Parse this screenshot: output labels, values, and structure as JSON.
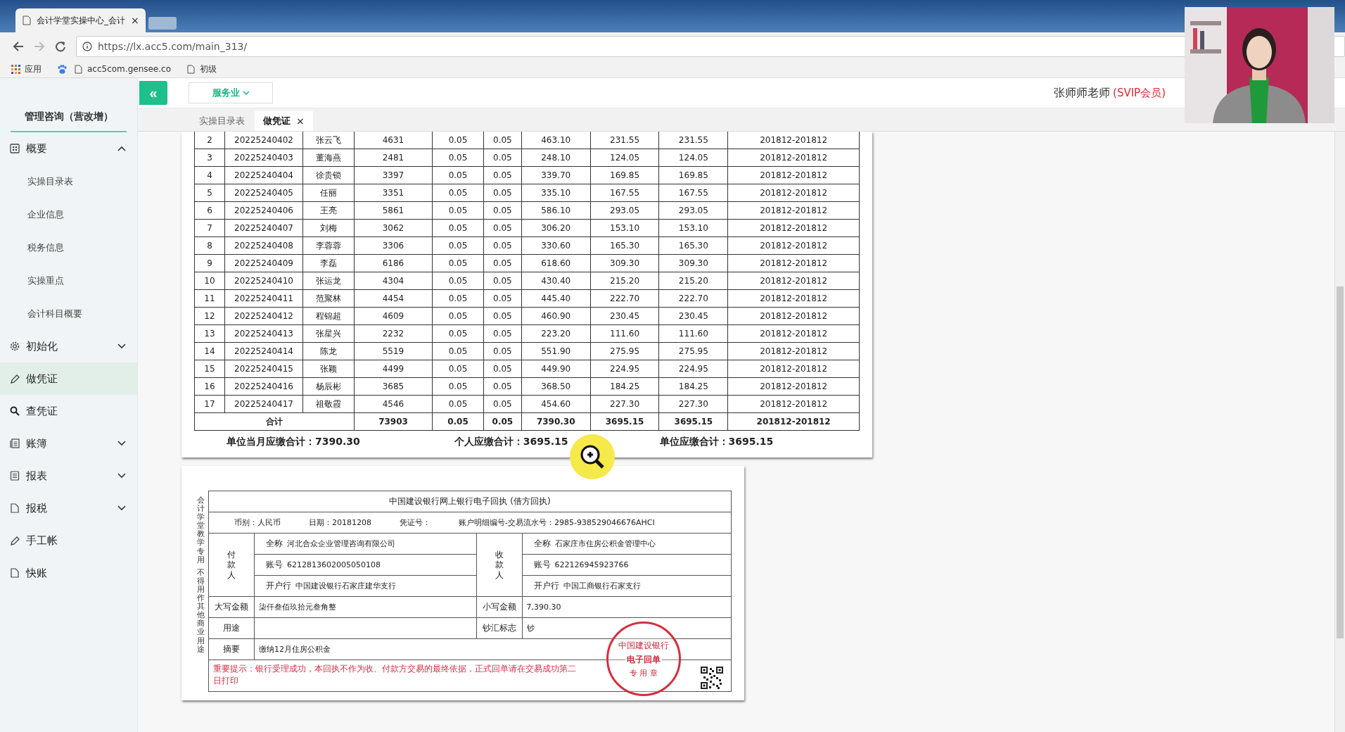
{
  "browser": {
    "tab_title": "会计学堂实操中心_会计",
    "tab_close": "×",
    "url": "https://lx.acc5.com/main_313/",
    "bookmarks": [
      "应用",
      "acc5com.gensee.co",
      "初级"
    ]
  },
  "sidebar": {
    "company": "管理咨询（营改增）",
    "items": [
      {
        "label": "概要",
        "selected": false,
        "expanded": true,
        "children": [
          {
            "label": "实操目录表",
            "selected": false
          },
          {
            "label": "企业信息",
            "selected": false
          },
          {
            "label": "税务信息",
            "selected": false
          },
          {
            "label": "实操重点",
            "selected": false
          },
          {
            "label": "会计科目概要",
            "selected": false
          }
        ]
      },
      {
        "label": "初始化",
        "selected": false,
        "expanded": false
      },
      {
        "label": "做凭证",
        "selected": true
      },
      {
        "label": "查凭证",
        "selected": false
      },
      {
        "label": "账簿",
        "selected": false,
        "expanded": false
      },
      {
        "label": "报表",
        "selected": false,
        "expanded": false
      },
      {
        "label": "报税",
        "selected": false,
        "expanded": false
      },
      {
        "label": "手工帐",
        "selected": false
      },
      {
        "label": "快账",
        "selected": false
      }
    ]
  },
  "header": {
    "collapse": "«",
    "industry": "服务业",
    "user": "张师师老师",
    "badge": "(SVIP会员)"
  },
  "tabs": [
    {
      "label": "实操目录表",
      "selected": false
    },
    {
      "label": "做凭证",
      "selected": true,
      "close": "×"
    }
  ],
  "table": {
    "rows": [
      [
        "2",
        "20225240402",
        "张云飞",
        "4631",
        "0.05",
        "0.05",
        "463.10",
        "231.55",
        "231.55",
        "201812-201812"
      ],
      [
        "3",
        "20225240403",
        "董海燕",
        "2481",
        "0.05",
        "0.05",
        "248.10",
        "124.05",
        "124.05",
        "201812-201812"
      ],
      [
        "4",
        "20225240404",
        "徐贵锁",
        "3397",
        "0.05",
        "0.05",
        "339.70",
        "169.85",
        "169.85",
        "201812-201812"
      ],
      [
        "5",
        "20225240405",
        "任丽",
        "3351",
        "0.05",
        "0.05",
        "335.10",
        "167.55",
        "167.55",
        "201812-201812"
      ],
      [
        "6",
        "20225240406",
        "王亮",
        "5861",
        "0.05",
        "0.05",
        "586.10",
        "293.05",
        "293.05",
        "201812-201812"
      ],
      [
        "7",
        "20225240407",
        "刘梅",
        "3062",
        "0.05",
        "0.05",
        "306.20",
        "153.10",
        "153.10",
        "201812-201812"
      ],
      [
        "8",
        "20225240408",
        "李蓉蓉",
        "3306",
        "0.05",
        "0.05",
        "330.60",
        "165.30",
        "165.30",
        "201812-201812"
      ],
      [
        "9",
        "20225240409",
        "李磊",
        "6186",
        "0.05",
        "0.05",
        "618.60",
        "309.30",
        "309.30",
        "201812-201812"
      ],
      [
        "10",
        "20225240410",
        "张运龙",
        "4304",
        "0.05",
        "0.05",
        "430.40",
        "215.20",
        "215.20",
        "201812-201812"
      ],
      [
        "11",
        "20225240411",
        "范聚林",
        "4454",
        "0.05",
        "0.05",
        "445.40",
        "222.70",
        "222.70",
        "201812-201812"
      ],
      [
        "12",
        "20225240412",
        "程锦超",
        "4609",
        "0.05",
        "0.05",
        "460.90",
        "230.45",
        "230.45",
        "201812-201812"
      ],
      [
        "13",
        "20225240413",
        "张星兴",
        "2232",
        "0.05",
        "0.05",
        "223.20",
        "111.60",
        "111.60",
        "201812-201812"
      ],
      [
        "14",
        "20225240414",
        "陈龙",
        "5519",
        "0.05",
        "0.05",
        "551.90",
        "275.95",
        "275.95",
        "201812-201812"
      ],
      [
        "15",
        "20225240415",
        "张颖",
        "4499",
        "0.05",
        "0.05",
        "449.90",
        "224.95",
        "224.95",
        "201812-201812"
      ],
      [
        "16",
        "20225240416",
        "杨辰彬",
        "3685",
        "0.05",
        "0.05",
        "368.50",
        "184.25",
        "184.25",
        "201812-201812"
      ],
      [
        "17",
        "20225240417",
        "祖敬霞",
        "4546",
        "0.05",
        "0.05",
        "454.60",
        "227.30",
        "227.30",
        "201812-201812"
      ]
    ],
    "sum_row": {
      "label": "合计",
      "cells": [
        "73903",
        "0.05",
        "0.05",
        "7390.30",
        "3695.15",
        "3695.15",
        "201812-201812"
      ]
    },
    "totals": [
      "单位当月应缴合计：7390.30",
      "个人应缴合计：3695.15",
      "单位应缴合计：3695.15"
    ]
  },
  "receipt": {
    "side_note": [
      "会计学堂教学专用",
      "不得用作其他商业用途"
    ],
    "title": "中国建设银行网上银行电子回执 (借方回执)",
    "info": [
      "币别：人民币",
      "日期：20181208",
      "凭证号：",
      "账户明细编号-交易流水号：2985-938529046676AHCI"
    ],
    "payer": {
      "label": "付款人",
      "fields": [
        {
          "label": "全称",
          "value": "河北合众企业管理咨询有限公司"
        },
        {
          "label": "账号",
          "value": "6212813602005050108"
        },
        {
          "label": "开户行",
          "value": "中国建设银行石家庄建华支行"
        }
      ]
    },
    "payee": {
      "label": "收款人",
      "fields": [
        {
          "label": "全称",
          "value": "石家庄市住房公积金管理中心"
        },
        {
          "label": "账号",
          "value": "622126945923766"
        },
        {
          "label": "开户行",
          "value": "中国工商银行石家支行"
        }
      ]
    },
    "amount_words_label": "大写金额",
    "amount_words": "柒仟叁佰玖拾元叁角整",
    "amount_label": "小写金额",
    "amount": "7,390.30",
    "usage_label": "用途",
    "cash_label": "钞汇标志",
    "cash": "钞",
    "summary_label": "摘要",
    "summary": "缴纳12月住房公积金",
    "notice": "重要提示：银行受理成功，本回执不作为收、付款方交易的最终依据，正式回单请在交易成功第二日打印",
    "stamp": {
      "top": "中国建设银行",
      "middle": "电子回单",
      "bottom": "专 用 章"
    }
  }
}
